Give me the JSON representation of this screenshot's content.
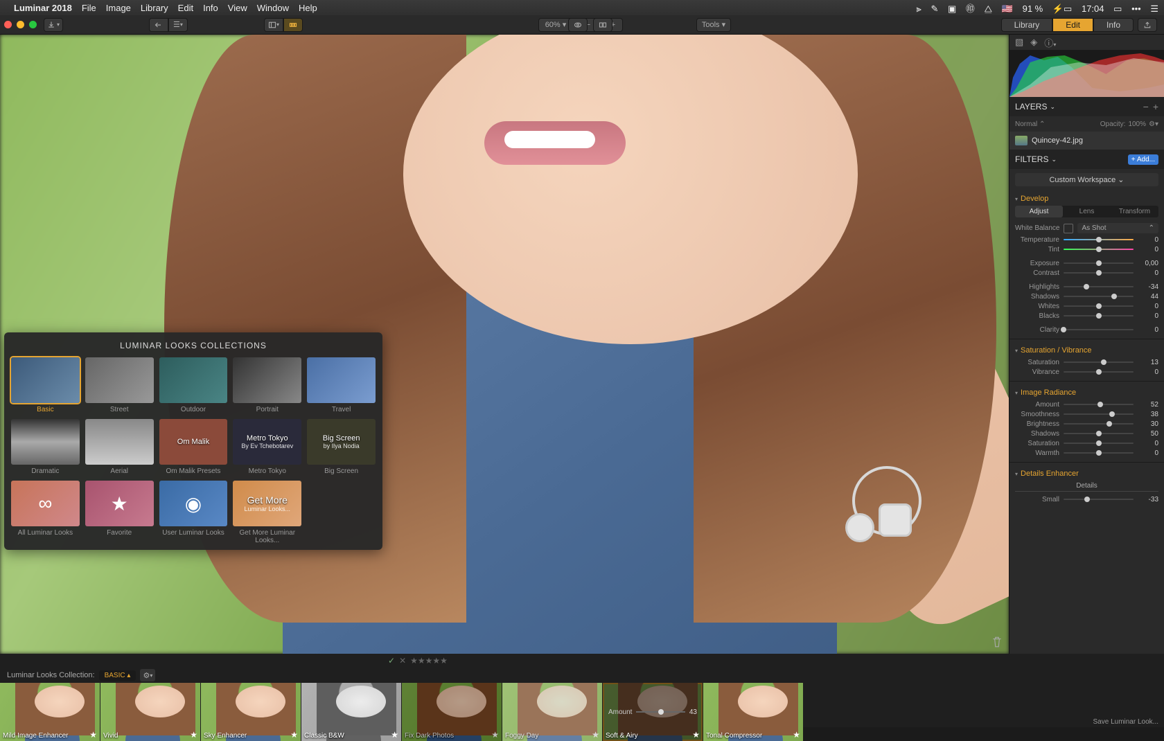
{
  "menubar": {
    "app": "Luminar 2018",
    "items": [
      "File",
      "Image",
      "Library",
      "Edit",
      "Info",
      "View",
      "Window",
      "Help"
    ],
    "battery": "91 %",
    "clock": "17:04"
  },
  "toolbar": {
    "zoom": "60%",
    "tools": "Tools"
  },
  "workspace_tabs": {
    "library": "Library",
    "edit": "Edit",
    "info": "Info"
  },
  "looks_popup": {
    "title": "LUMINAR LOOKS COLLECTIONS",
    "row1": [
      {
        "name": "Basic"
      },
      {
        "name": "Street"
      },
      {
        "name": "Outdoor"
      },
      {
        "name": "Portrait"
      },
      {
        "name": "Travel"
      }
    ],
    "row2": [
      {
        "name": "Dramatic"
      },
      {
        "name": "Aerial"
      },
      {
        "name": "Om Malik Presets",
        "overlay": "Om Malik"
      },
      {
        "name": "Metro Tokyo",
        "overlay": "Metro Tokyo",
        "sub": "By Ev Tchebotarev"
      },
      {
        "name": "Big Screen",
        "overlay": "Big Screen",
        "sub": "by Ilya Nodia"
      }
    ],
    "row3": [
      {
        "name": "All Luminar Looks"
      },
      {
        "name": "Favorite"
      },
      {
        "name": "User Luminar Looks"
      },
      {
        "name": "Get More Luminar Looks...",
        "overlay": "Get More",
        "sub": "Luminar Looks..."
      }
    ]
  },
  "sidebar": {
    "layers": {
      "title": "LAYERS",
      "blend": "Normal",
      "opacity_label": "Opacity:",
      "opacity": "100%",
      "layer_name": "Quincey-42.jpg"
    },
    "filters": {
      "title": "FILTERS",
      "add": "+ Add...",
      "workspace": "Custom Workspace"
    },
    "develop": {
      "title": "Develop",
      "tabs": {
        "adjust": "Adjust",
        "lens": "Lens",
        "transform": "Transform"
      },
      "wb_label": "White Balance",
      "wb_mode": "As Shot",
      "sliders": [
        {
          "label": "Temperature",
          "val": "0",
          "pos": 50,
          "color": "color1"
        },
        {
          "label": "Tint",
          "val": "0",
          "pos": 50,
          "color": "color2"
        },
        {
          "label": "Exposure",
          "val": "0,00",
          "pos": 50
        },
        {
          "label": "Contrast",
          "val": "0",
          "pos": 50
        },
        {
          "label": "Highlights",
          "val": "-34",
          "pos": 33
        },
        {
          "label": "Shadows",
          "val": "44",
          "pos": 72
        },
        {
          "label": "Whites",
          "val": "0",
          "pos": 50
        },
        {
          "label": "Blacks",
          "val": "0",
          "pos": 50
        },
        {
          "label": "Clarity",
          "val": "0",
          "pos": 0
        }
      ]
    },
    "satvib": {
      "title": "Saturation / Vibrance",
      "sliders": [
        {
          "label": "Saturation",
          "val": "13",
          "pos": 57
        },
        {
          "label": "Vibrance",
          "val": "0",
          "pos": 50
        }
      ]
    },
    "radiance": {
      "title": "Image Radiance",
      "sliders": [
        {
          "label": "Amount",
          "val": "52",
          "pos": 52
        },
        {
          "label": "Smoothness",
          "val": "38",
          "pos": 69
        },
        {
          "label": "Brightness",
          "val": "30",
          "pos": 65
        },
        {
          "label": "Shadows",
          "val": "50",
          "pos": 50
        },
        {
          "label": "Saturation",
          "val": "0",
          "pos": 50
        },
        {
          "label": "Warmth",
          "val": "0",
          "pos": 50
        }
      ]
    },
    "details": {
      "title": "Details Enhancer",
      "subhead": "Details",
      "sliders": [
        {
          "label": "Small",
          "val": "-33",
          "pos": 34
        }
      ]
    },
    "save": "Save Luminar Look..."
  },
  "filmstrip": {
    "collection_label": "Luminar Looks Collection:",
    "collection": "BASIC",
    "items": [
      {
        "name": "Mild Image Enhancer"
      },
      {
        "name": "Vivid"
      },
      {
        "name": "Sky Enhancer"
      },
      {
        "name": "Classic B&W"
      },
      {
        "name": "Fix Dark Photos"
      },
      {
        "name": "Foggy Day"
      },
      {
        "name": "Soft & Airy",
        "selected": true,
        "amount_label": "Amount",
        "amount": "43"
      },
      {
        "name": "Tonal Compressor"
      }
    ]
  }
}
